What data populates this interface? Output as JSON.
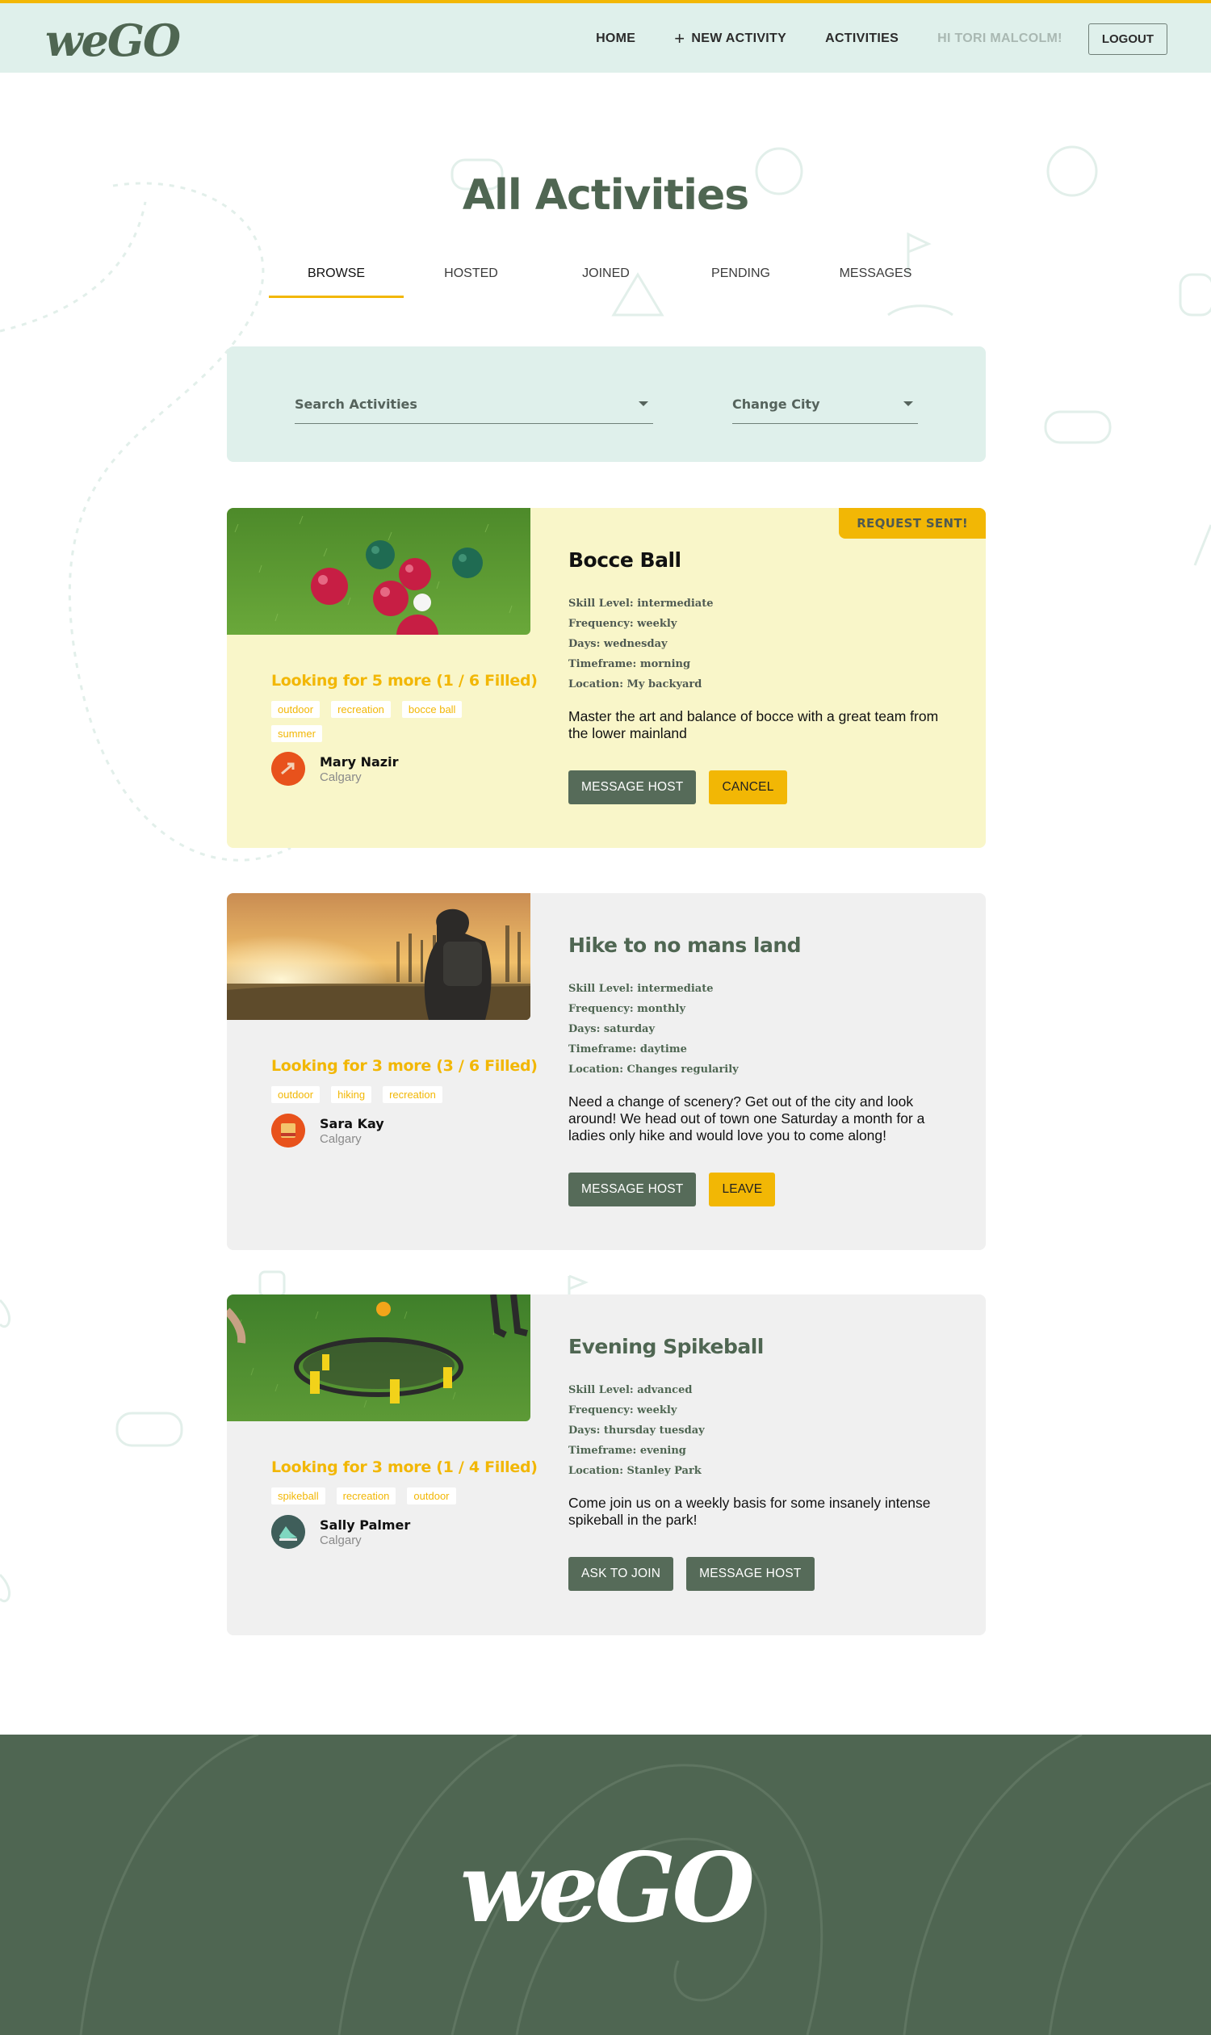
{
  "header": {
    "logo": "weGO",
    "nav": {
      "home": "HOME",
      "new_activity": "NEW ACTIVITY",
      "activities": "ACTIVITIES",
      "greeting": "HI TORI MALCOLM!",
      "logout": "LOGOUT"
    }
  },
  "page": {
    "title": "All Activities",
    "tabs": [
      "BROWSE",
      "HOSTED",
      "JOINED",
      "PENDING",
      "MESSAGES"
    ],
    "active_tab": "BROWSE"
  },
  "search": {
    "activities_label": "Search Activities",
    "city_label": "Change City"
  },
  "activities": [
    {
      "title": "Bocce Ball",
      "status_badge": "REQUEST SENT!",
      "looking_for": "Looking for 5 more (1 / 6 Filled)",
      "tags": [
        "outdoor",
        "recreation",
        "bocce ball",
        "summer"
      ],
      "host": {
        "name": "Mary Nazir",
        "city": "Calgary"
      },
      "details": [
        "Skill Level: intermediate",
        "Frequency: weekly",
        "Days: wednesday",
        "Timeframe: morning",
        "Location: My backyard"
      ],
      "description": "Master the art and balance of bocce with a great team from the lower mainland",
      "buttons": [
        "MESSAGE HOST",
        "CANCEL"
      ]
    },
    {
      "title": "Hike to no mans land",
      "looking_for": "Looking for 3 more (3 / 6 Filled)",
      "tags": [
        "outdoor",
        "hiking",
        "recreation"
      ],
      "host": {
        "name": "Sara Kay",
        "city": "Calgary"
      },
      "details": [
        "Skill Level: intermediate",
        "Frequency: monthly",
        "Days: saturday",
        "Timeframe: daytime",
        "Location: Changes regularily"
      ],
      "description": "Need a change of scenery? Get out of the city and look around! We head out of town one Saturday a month for a ladies only hike and would love you to come along!",
      "buttons": [
        "MESSAGE HOST",
        "LEAVE"
      ]
    },
    {
      "title": "Evening Spikeball",
      "looking_for": "Looking for 3 more (1 / 4 Filled)",
      "tags": [
        "spikeball",
        "recreation",
        "outdoor"
      ],
      "host": {
        "name": "Sally Palmer",
        "city": "Calgary"
      },
      "details": [
        "Skill Level: advanced",
        "Frequency: weekly",
        "Days: thursday tuesday",
        "Timeframe: evening",
        "Location: Stanley Park"
      ],
      "description": "Come join us on a weekly basis for some insanely intense spikeball in the park!",
      "buttons": [
        "ASK TO JOIN",
        "MESSAGE HOST"
      ]
    }
  ],
  "footer": {
    "logo": "weGO"
  },
  "colors": {
    "brand_green": "#4f6652",
    "accent_yellow": "#f2b705",
    "mint": "#dff0eb",
    "pending_card": "#f9f6c9",
    "card_gray": "#f0f0f0"
  }
}
